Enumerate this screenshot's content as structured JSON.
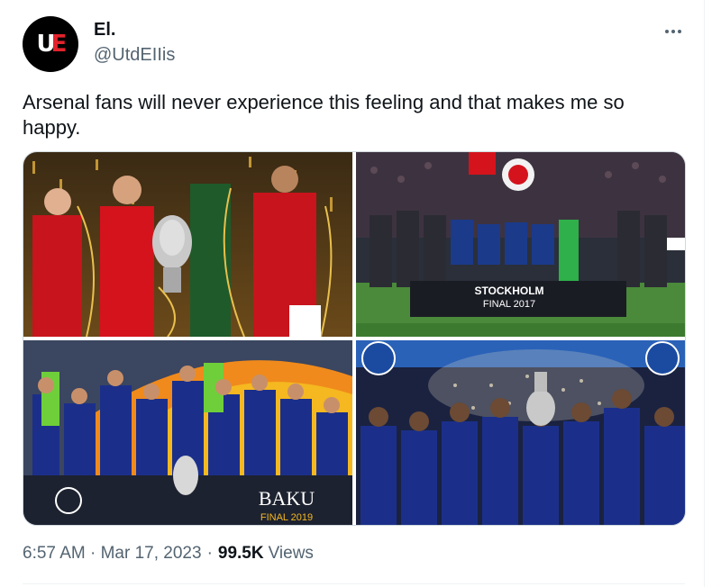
{
  "author": {
    "display_name": "El.",
    "handle": "@UtdEIIis",
    "avatar_logo_text": "UE"
  },
  "tweet": {
    "text": "Arsenal fans will never experience this feeling and that makes me so happy.",
    "timestamp": "6:57 AM · Mar 17, 2023",
    "views_count": "99.5K",
    "views_label": "Views"
  },
  "media": {
    "photos": [
      {
        "description_icon": "trophy-celebration-photo"
      },
      {
        "description_icon": "trophy-celebration-photo",
        "banner_line1": "STOCKHOLM",
        "banner_line2": "FINAL 2017"
      },
      {
        "description_icon": "trophy-celebration-photo",
        "banner_line1": "BAKU",
        "banner_line2": "FINAL 2019"
      },
      {
        "description_icon": "trophy-celebration-photo"
      }
    ]
  },
  "colors": {
    "text_primary": "#0f1419",
    "text_secondary": "#536471",
    "united_red": "#d4131c",
    "chelsea_blue": "#1b2f8a"
  }
}
